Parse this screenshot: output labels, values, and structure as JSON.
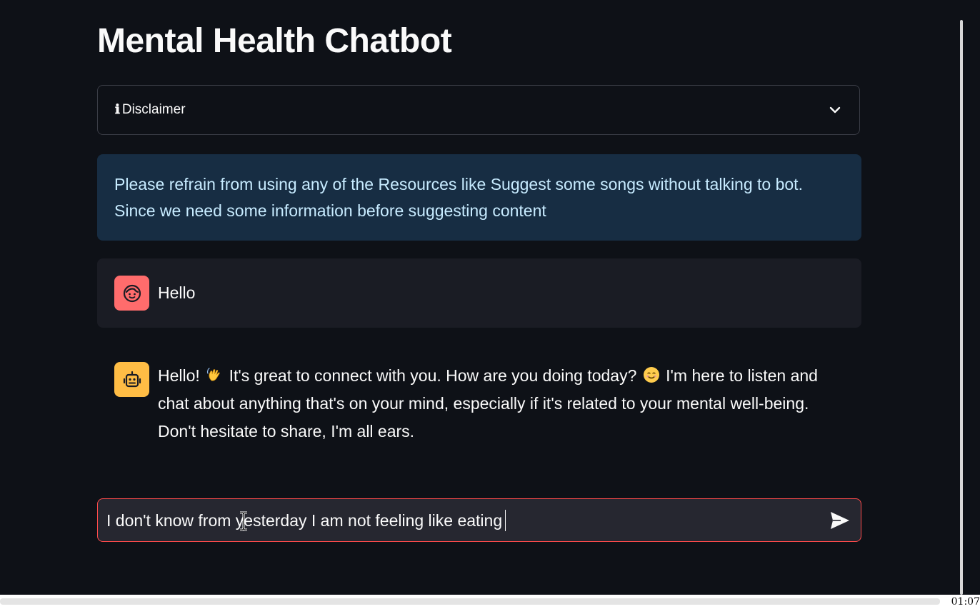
{
  "app": {
    "title": "Mental Health Chatbot"
  },
  "disclaimer": {
    "icon": "info-icon",
    "info_glyph": "ℹ",
    "label": "Disclaimer",
    "chevron": "chevron-down-icon"
  },
  "info_box": {
    "text": "Please refrain from using any of the Resources like Suggest some songs without talking to bot. Since we need some information before suggesting content"
  },
  "messages": [
    {
      "role": "user",
      "avatar_icon": "user-face-icon",
      "parts": [
        "Hello"
      ]
    },
    {
      "role": "assistant",
      "avatar_icon": "robot-icon",
      "parts": [
        "Hello! ",
        " It's great to connect with you. How are you doing today? ",
        " I'm here to listen and chat about anything that's on your mind, especially if it's related to your mental well-being. Don't hesitate to share, I'm all ears."
      ],
      "emojis": [
        "waving-hand-emoji",
        "smiling-face-emoji"
      ]
    }
  ],
  "chat_input": {
    "value": "I don't know from yesterday I am not feeling like eating",
    "send_icon": "send-icon"
  },
  "video_bar": {
    "time": "01:07"
  },
  "colors": {
    "background": "#0e1117",
    "accent": "#ff4b4b",
    "info_bg": "#172d43",
    "user_avatar": "#ff6c6c",
    "bot_avatar": "#ffbd45"
  }
}
